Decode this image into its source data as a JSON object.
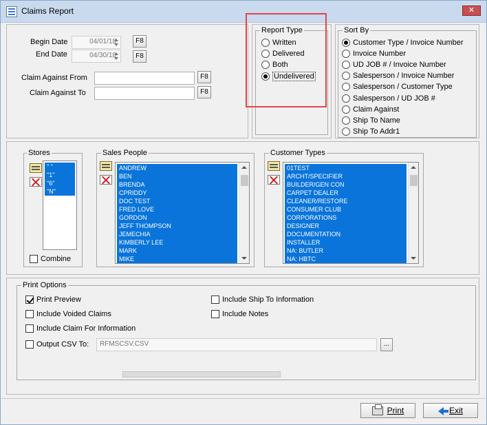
{
  "window": {
    "title": "Claims Report",
    "close_label": "✕"
  },
  "dates": {
    "begin_label": "Begin Date",
    "begin_value": "04/01/18",
    "end_label": "End Date",
    "end_value": "04/30/18",
    "f8": "F8"
  },
  "claim_against": {
    "from_label": "Claim Against From",
    "from_value": "",
    "to_label": "Claim Against To",
    "to_value": "",
    "f8": "F8"
  },
  "report_type": {
    "title": "Report Type",
    "options": [
      "Written",
      "Delivered",
      "Both",
      "Undelivered"
    ],
    "selected": "Undelivered"
  },
  "sort_by": {
    "title": "Sort By",
    "options": [
      "Customer Type / Invoice Number",
      "Invoice Number",
      "UD JOB # / Invoice Number",
      "Salesperson / Invoice Number",
      "Salesperson / Customer Type",
      "Salesperson / UD JOB #",
      "Claim Against",
      "Ship To Name",
      "Ship To Addr1"
    ],
    "selected": "Customer Type / Invoice Number"
  },
  "stores": {
    "title": "Stores",
    "items": [
      "\" \"",
      "\"1\"",
      "\"6\"",
      "\"N\""
    ],
    "combine_label": "Combine",
    "combine_checked": false
  },
  "sales_people": {
    "title": "Sales People",
    "items": [
      "ANDREW",
      "BEN",
      "BRENDA",
      "CPRIDDY",
      "DOC TEST",
      "FRED LOVE",
      "GORDON",
      "JEFF THOMPSON",
      "JEMECHIA",
      "KIMBERLY LEE",
      "MARK",
      "MIKE"
    ]
  },
  "customer_types": {
    "title": "Customer Types",
    "items": [
      "01TEST",
      "ARCHT/SPECIFIER",
      "BUILDER/GEN CON",
      "CARPET DEALER",
      "CLEANER/RESTORE",
      "CONSUMER CLUB",
      "CORPORATIONS",
      "DESIGNER",
      "DOCUMENTATION",
      "INSTALLER",
      "NA: BUTLER",
      "NA: HBTC"
    ]
  },
  "print_options": {
    "title": "Print Options",
    "print_preview": "Print Preview",
    "include_voided": "Include Voided Claims",
    "include_claim_for": "Include Claim For Information",
    "include_ship_to": "Include Ship To Information",
    "include_notes": "Include Notes",
    "output_csv_label": "Output CSV To:",
    "csv_value": "RFMSCSV.CSV",
    "browse_label": "..."
  },
  "buttons": {
    "print": "Print",
    "exit": "Exit"
  },
  "colors": {
    "selection": "#0a74da",
    "highlight": "#e0454a",
    "titlebar": "#c9daee"
  }
}
